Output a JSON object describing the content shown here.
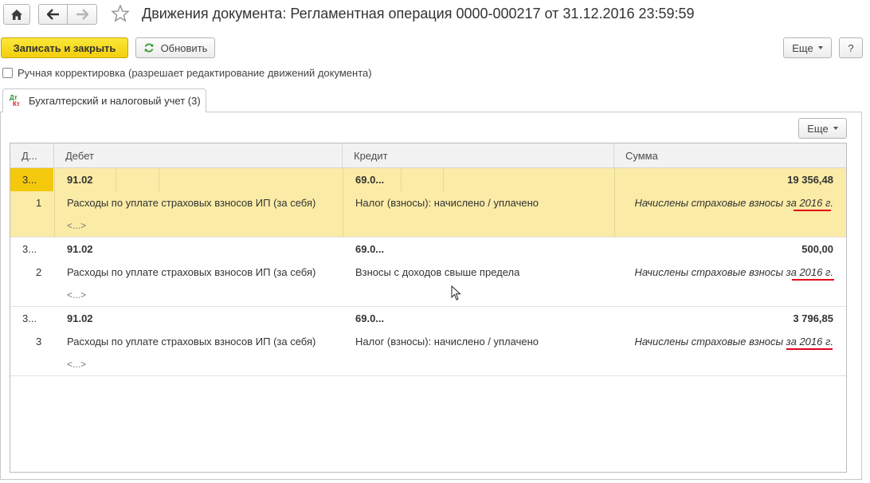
{
  "window": {
    "title": "Движения документа: Регламентная операция 0000-000217 от 31.12.2016 23:59:59"
  },
  "nav": {
    "home_icon": "home-icon",
    "back_icon": "arrow-left-icon",
    "forward_icon": "arrow-right-icon",
    "favorite_icon": "star-icon"
  },
  "toolbar": {
    "save_close_label": "Записать и закрыть",
    "refresh_label": "Обновить",
    "more_label": "Еще",
    "help_label": "?"
  },
  "manual_edit": {
    "label": "Ручная корректировка (разрешает редактирование движений документа)",
    "checked": false
  },
  "tab": {
    "label": "Бухгалтерский и налоговый учет (3)",
    "icon_top": "Дт",
    "icon_bottom": "Кт"
  },
  "grid_toolbar": {
    "more_label": "Еще"
  },
  "table": {
    "columns": [
      "Д...",
      "Дебет",
      "Кредит",
      "Сумма"
    ],
    "rows": [
      {
        "date": "3...",
        "line_no": "1",
        "debit_account": "91.02",
        "debit_subconto": "Расходы по уплате страховых взносов ИП (за себя)",
        "debit_subconto2": "<...>",
        "credit_account": "69.0...",
        "credit_subconto": "Налог (взносы): начислено / уплачено",
        "sum": "19 356,48",
        "content_text": "Начислены страховые взносы за",
        "content_year": "2016 г.",
        "selected": true
      },
      {
        "date": "3...",
        "line_no": "2",
        "debit_account": "91.02",
        "debit_subconto": "Расходы по уплате страховых взносов ИП (за себя)",
        "debit_subconto2": "<...>",
        "credit_account": "69.0...",
        "credit_subconto": "Взносы с доходов свыше предела",
        "sum": "500,00",
        "content_text": "Начислены страховые взносы за",
        "content_year": "2016 г.",
        "selected": false
      },
      {
        "date": "3...",
        "line_no": "3",
        "debit_account": "91.02",
        "debit_subconto": "Расходы по уплате страховых взносов ИП (за себя)",
        "debit_subconto2": "<...>",
        "credit_account": "69.0...",
        "credit_subconto": "Налог (взносы): начислено / уплачено",
        "sum": "3 796,85",
        "content_text": "Начислены страховые взносы за",
        "content_year": "2016 г.",
        "selected": false
      }
    ]
  },
  "colors": {
    "primary_button": "#f5d215",
    "selected_row": "#faeba6",
    "selected_cell": "#f4c80c",
    "underline": "#e3001b"
  }
}
